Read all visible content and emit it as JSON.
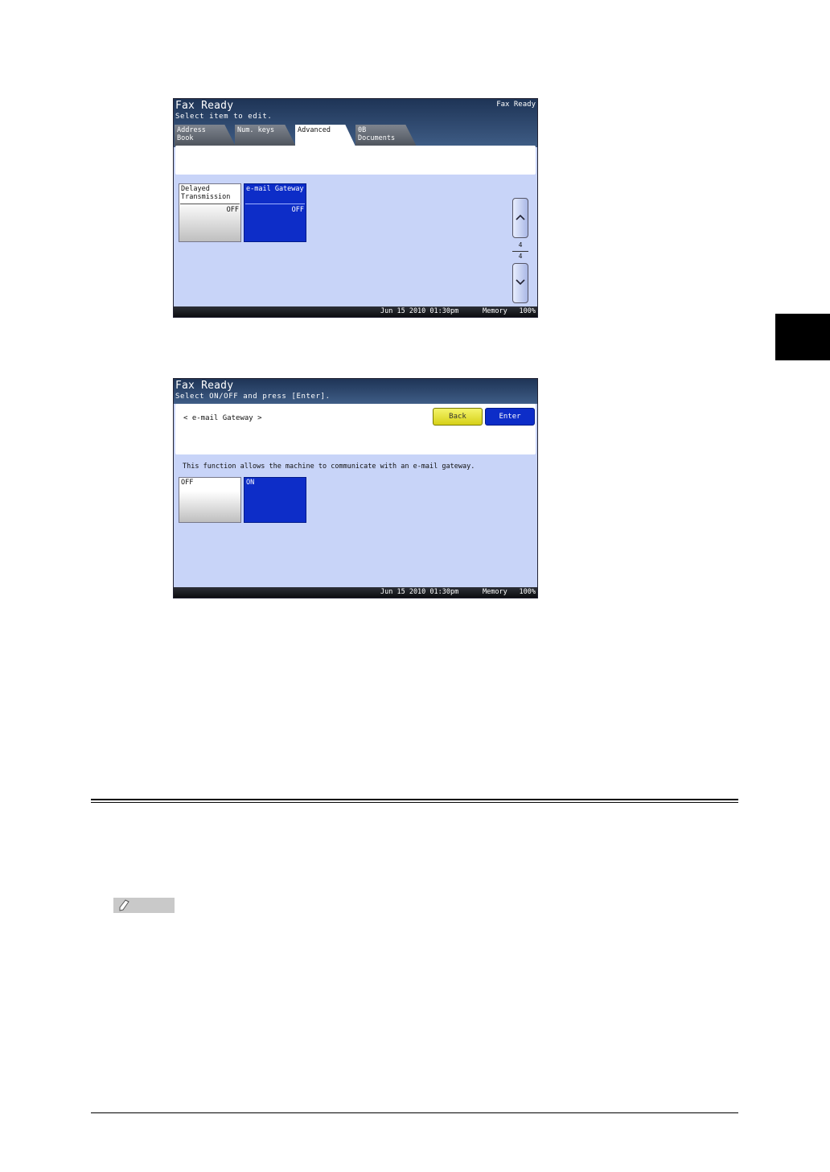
{
  "screen1": {
    "title": "Fax Ready",
    "subtitle": "Select item to edit.",
    "status_right": "Fax Ready",
    "tabs": [
      {
        "line1": "Address",
        "line2": "Book"
      },
      {
        "line1": "Num. keys",
        "line2": ""
      },
      {
        "line1": "Advanced",
        "line2": ""
      },
      {
        "line1": "0B",
        "line2": "Documents"
      }
    ],
    "tiles": [
      {
        "line1": "Delayed",
        "line2": "Transmission",
        "value": "OFF"
      },
      {
        "line1": "e-mail Gateway",
        "line2": "",
        "value": "OFF"
      }
    ],
    "page_current": "4",
    "page_total": "4",
    "footer": {
      "datetime": "Jun 15 2010 01:30pm",
      "memory": "Memory",
      "percent": "100%"
    }
  },
  "screen2": {
    "title": "Fax Ready",
    "subtitle": "Select ON/OFF and press [Enter].",
    "gateway_label": "< e-mail Gateway >",
    "back_label": "Back",
    "enter_label": "Enter",
    "description": "This function allows the machine to communicate with an e-mail gateway.",
    "options": [
      "OFF",
      "ON"
    ],
    "footer": {
      "datetime": "Jun 15 2010 01:30pm",
      "memory": "Memory",
      "percent": "100%"
    }
  }
}
